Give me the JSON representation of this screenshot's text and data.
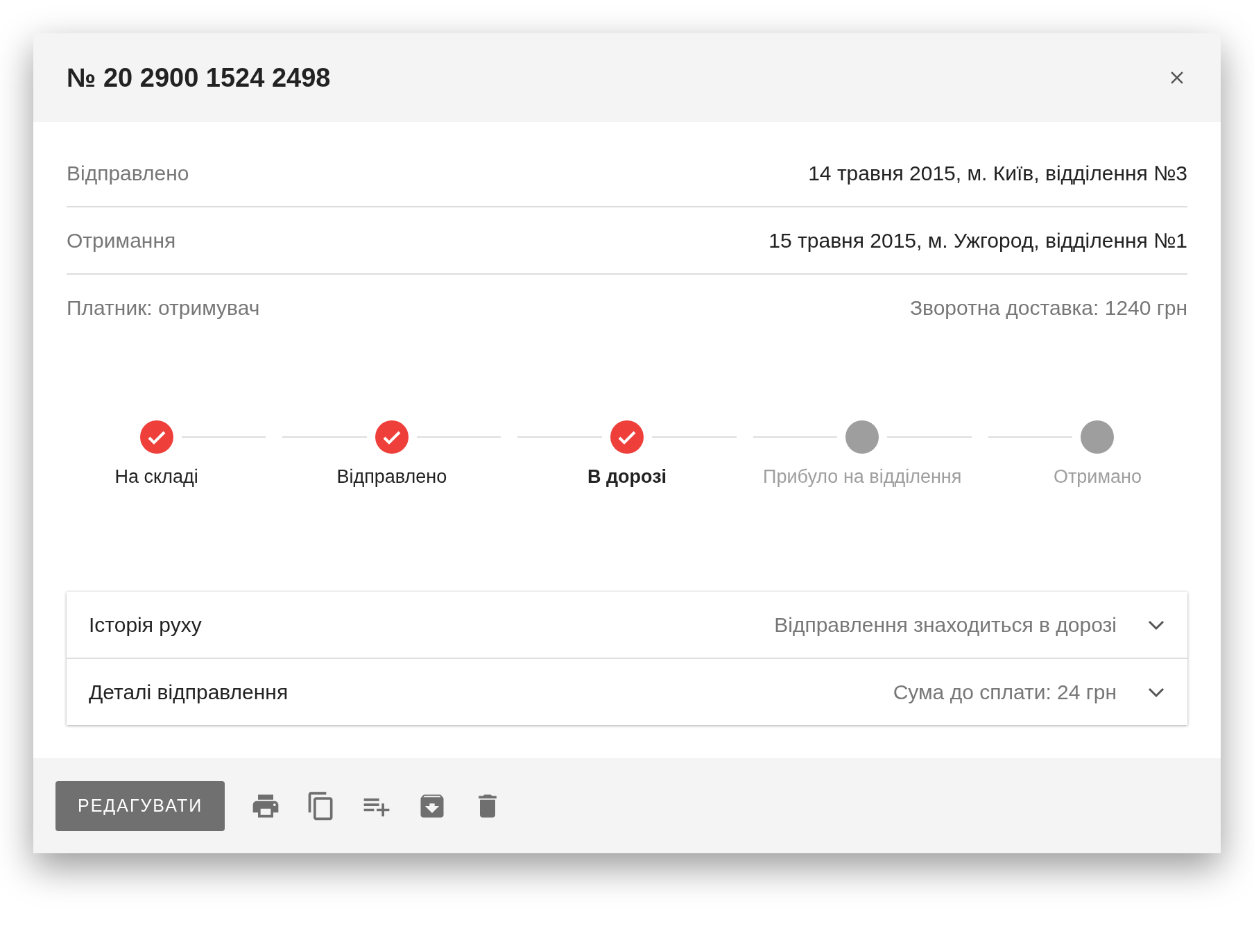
{
  "dialog": {
    "title": "№ 20 2900 1524 2498"
  },
  "info_rows": [
    {
      "label": "Відправлено",
      "value": "14 травня 2015, м. Київ, відділення №3",
      "kind": "strong"
    },
    {
      "label": "Отримання",
      "value": "15 травня 2015, м. Ужгород, відділення №1",
      "kind": "strong"
    },
    {
      "label": "Платник: отримувач",
      "value": "Зворотна доставка: 1240 грн",
      "kind": "muted"
    }
  ],
  "steps": [
    {
      "label": "На складі",
      "done": true,
      "selected": false
    },
    {
      "label": "Відправлено",
      "done": true,
      "selected": false
    },
    {
      "label": "В дорозі",
      "done": true,
      "selected": true
    },
    {
      "label": "Прибуло на відділення",
      "done": false,
      "selected": false
    },
    {
      "label": "Отримано",
      "done": false,
      "selected": false
    }
  ],
  "panels": [
    {
      "title": "Історія руху",
      "summary": "Відправлення знаходиться в дорозі",
      "expanded": false
    },
    {
      "title": "Деталі відправлення",
      "summary": "Сума до сплати: 24 грн",
      "expanded": false
    }
  ],
  "footer": {
    "button": "РЕДАГУВАТИ",
    "actions": [
      {
        "kind": "print"
      },
      {
        "kind": "copy"
      },
      {
        "kind": "playlist-add"
      },
      {
        "kind": "archive"
      },
      {
        "kind": "delete"
      }
    ]
  }
}
